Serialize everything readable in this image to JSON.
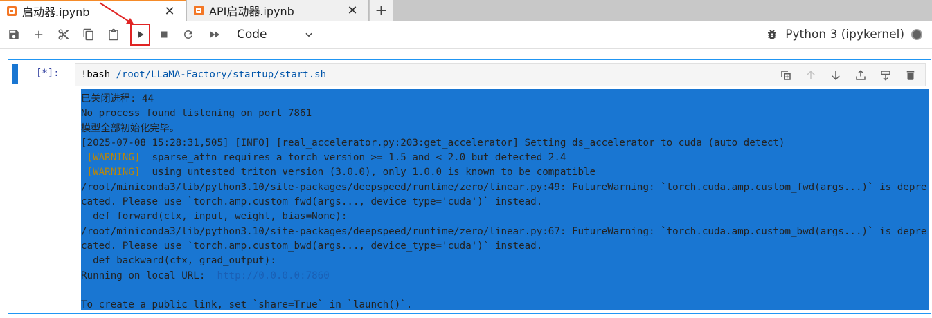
{
  "tabs": [
    {
      "title": "启动器.ipynb",
      "close": "✕",
      "active": true
    },
    {
      "title": "API启动器.ipynb",
      "close": "✕",
      "active": false
    }
  ],
  "add_tab_label": "+",
  "toolbar": {
    "buttons": [
      "save-icon",
      "add-cell-icon",
      "cut-icon",
      "copy-icon",
      "paste-icon",
      "run-icon",
      "stop-icon",
      "restart-icon",
      "fast-forward-icon"
    ],
    "cell_type": "Code",
    "kernel_name": "Python 3 (ipykernel)"
  },
  "cell": {
    "prompt": "[*]:",
    "source_cmd": "!bash ",
    "source_path": "/root/LLaMA-Factory/startup/start",
    "source_ext": ".sh",
    "output_lines": [
      {
        "text": "已关闭进程: 44"
      },
      {
        "text": "No process found listening on port 7861"
      },
      {
        "text": "模型全部初始化完毕。"
      },
      {
        "text": "[2025-07-08 15:28:31,505] [INFO] [real_accelerator.py:203:get_accelerator] Setting ds_accelerator to cuda (auto detect)"
      },
      {
        "tag": " [WARNING] ",
        "text": " sparse_attn requires a torch version >= 1.5 and < 2.0 but detected 2.4"
      },
      {
        "tag": " [WARNING] ",
        "text": " using untested triton version (3.0.0), only 1.0.0 is known to be compatible"
      },
      {
        "text": "/root/miniconda3/lib/python3.10/site-packages/deepspeed/runtime/zero/linear.py:49: FutureWarning: `torch.cuda.amp.custom_fwd(args...)` is deprecated. Please use `torch.amp.custom_fwd(args..., device_type='cuda')` instead."
      },
      {
        "text": "  def forward(ctx, input, weight, bias=None):"
      },
      {
        "text": "/root/miniconda3/lib/python3.10/site-packages/deepspeed/runtime/zero/linear.py:67: FutureWarning: `torch.cuda.amp.custom_bwd(args...)` is deprecated. Please use `torch.amp.custom_bwd(args..., device_type='cuda')` instead."
      },
      {
        "text": "  def backward(ctx, grad_output):"
      },
      {
        "text": "Running on local URL:  ",
        "url": "http://0.0.0.0:7860"
      },
      {
        "text": ""
      },
      {
        "text": "To create a public link, set `share=True` in `launch()`."
      }
    ]
  },
  "colors": {
    "accent": "#2196f3",
    "annotation": "#e02424",
    "tab_icon": "#f37726"
  }
}
